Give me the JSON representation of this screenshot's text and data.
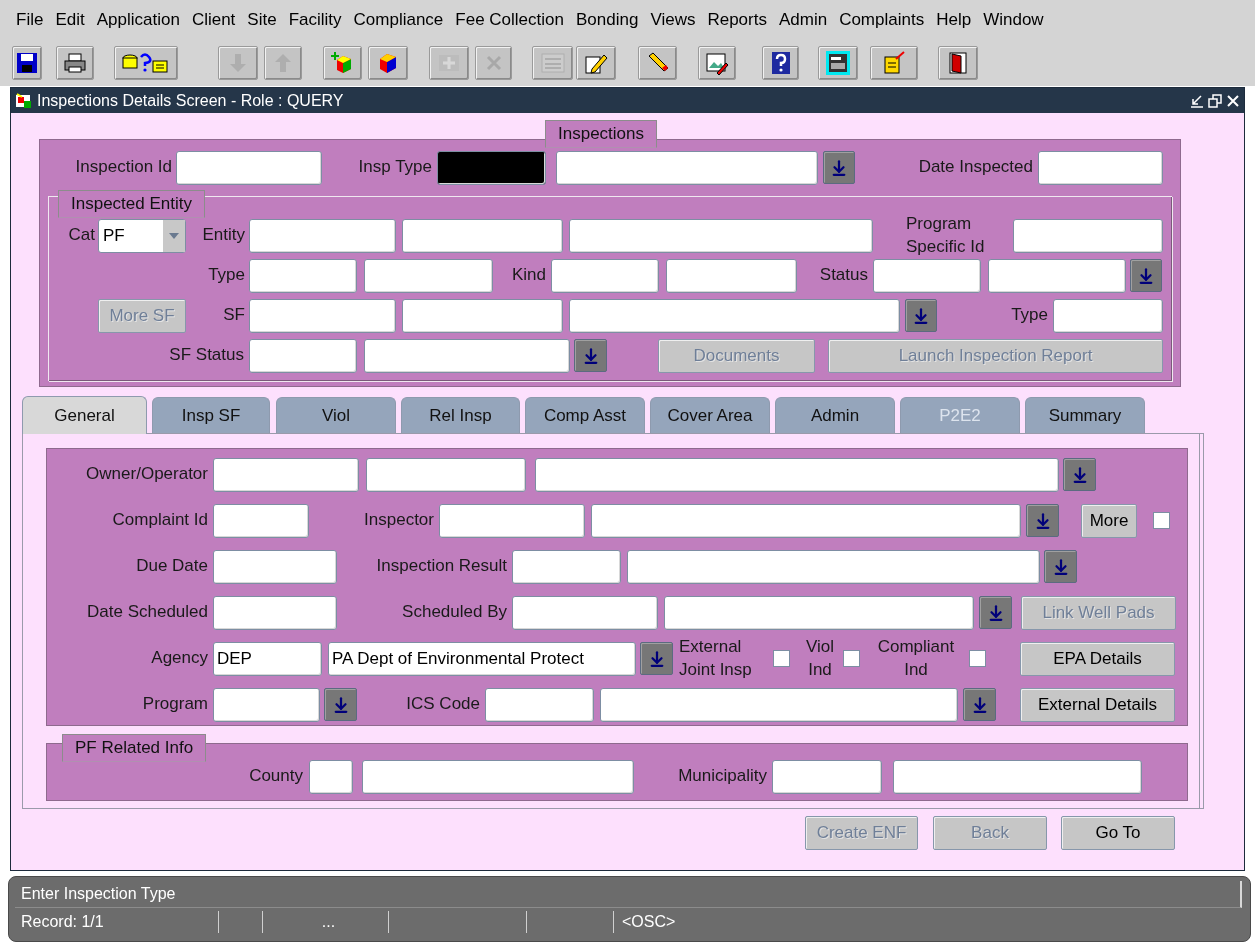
{
  "menu": [
    "File",
    "Edit",
    "Application",
    "Client",
    "Site",
    "Facility",
    "Compliance",
    "Fee Collection",
    "Bonding",
    "Views",
    "Reports",
    "Admin",
    "Complaints",
    "Help",
    "Window"
  ],
  "toolbar": [
    {
      "disabled": false
    },
    {
      "disabled": false
    },
    {
      "disabled": false
    },
    {
      "disabled": true
    },
    {
      "disabled": true
    },
    {
      "disabled": false
    },
    {
      "disabled": false
    },
    {
      "disabled": true
    },
    {
      "disabled": true
    },
    {
      "disabled": true
    },
    {
      "disabled": false
    },
    {
      "disabled": false
    },
    {
      "disabled": false
    },
    {
      "disabled": false
    },
    {
      "disabled": false
    },
    {
      "disabled": false
    },
    {
      "disabled": false
    }
  ],
  "window": {
    "title": "Inspections Details Screen - Role : QUERY"
  },
  "inspections": {
    "title": "Inspections",
    "rows": [
      {
        "items": [
          {
            "kind": "label",
            "text": "Inspection Id"
          },
          {
            "kind": "field"
          },
          {
            "kind": "label",
            "text": "Insp Type"
          },
          {
            "kind": "focused_field"
          },
          {
            "kind": "field"
          },
          {
            "kind": "lookup"
          },
          {
            "kind": "label",
            "text": "Date Inspected"
          },
          {
            "kind": "field"
          }
        ]
      }
    ],
    "entity": {
      "title": "Inspected Entity",
      "rows": [
        {
          "items": [
            {
              "kind": "label",
              "text": "Cat"
            },
            {
              "kind": "combo",
              "value": "PF"
            },
            {
              "kind": "label",
              "text": "Entity"
            },
            {
              "kind": "field"
            },
            {
              "kind": "field"
            },
            {
              "kind": "field"
            },
            {
              "kind": "label",
              "text": "Program Specific Id"
            },
            {
              "kind": "field"
            }
          ]
        },
        {
          "items": [
            {
              "kind": "label",
              "text": "Type"
            },
            {
              "kind": "field"
            },
            {
              "kind": "field"
            },
            {
              "kind": "label",
              "text": "Kind"
            },
            {
              "kind": "field"
            },
            {
              "kind": "field"
            },
            {
              "kind": "label",
              "text": "Status"
            },
            {
              "kind": "field"
            },
            {
              "kind": "field"
            },
            {
              "kind": "lookup"
            }
          ]
        },
        {
          "items": [
            {
              "kind": "button",
              "label": "More SF",
              "disabled": true
            },
            {
              "kind": "label",
              "text": "SF"
            },
            {
              "kind": "field"
            },
            {
              "kind": "field"
            },
            {
              "kind": "field"
            },
            {
              "kind": "lookup"
            },
            {
              "kind": "label",
              "text": "Type"
            },
            {
              "kind": "field"
            }
          ]
        },
        {
          "items": [
            {
              "kind": "label",
              "text": "SF Status"
            },
            {
              "kind": "field"
            },
            {
              "kind": "field"
            },
            {
              "kind": "lookup"
            },
            {
              "kind": "button",
              "label": "Documents",
              "disabled": true
            },
            {
              "kind": "button",
              "label": "Launch Inspection Report",
              "disabled": true
            }
          ]
        }
      ]
    }
  },
  "tabs": [
    {
      "label": "General",
      "selected": true,
      "disabled": false
    },
    {
      "label": "Insp SF",
      "selected": false,
      "disabled": false
    },
    {
      "label": "Viol",
      "selected": false,
      "disabled": false
    },
    {
      "label": "Rel Insp",
      "selected": false,
      "disabled": false
    },
    {
      "label": "Comp Asst",
      "selected": false,
      "disabled": false
    },
    {
      "label": "Cover Area",
      "selected": false,
      "disabled": false
    },
    {
      "label": "Admin",
      "selected": false,
      "disabled": false
    },
    {
      "label": "P2E2",
      "selected": false,
      "disabled": true
    },
    {
      "label": "Summary",
      "selected": false,
      "disabled": false
    }
  ],
  "general": {
    "rows": [
      {
        "items": [
          {
            "kind": "label",
            "text": "Owner/Operator"
          },
          {
            "kind": "field"
          },
          {
            "kind": "field"
          },
          {
            "kind": "field"
          },
          {
            "kind": "lookup"
          }
        ]
      },
      {
        "items": [
          {
            "kind": "label",
            "text": "Complaint Id"
          },
          {
            "kind": "field"
          },
          {
            "kind": "label",
            "text": "Inspector"
          },
          {
            "kind": "field"
          },
          {
            "kind": "field"
          },
          {
            "kind": "lookup"
          },
          {
            "kind": "button",
            "label": "More",
            "disabled": false
          },
          {
            "kind": "checkbox",
            "checked": false
          }
        ]
      },
      {
        "items": [
          {
            "kind": "label",
            "text": "Due Date"
          },
          {
            "kind": "field"
          },
          {
            "kind": "label",
            "text": "Inspection Result"
          },
          {
            "kind": "field"
          },
          {
            "kind": "field"
          },
          {
            "kind": "lookup"
          }
        ]
      },
      {
        "items": [
          {
            "kind": "label",
            "text": "Date Scheduled"
          },
          {
            "kind": "field"
          },
          {
            "kind": "label",
            "text": "Scheduled By"
          },
          {
            "kind": "field"
          },
          {
            "kind": "field"
          },
          {
            "kind": "lookup"
          },
          {
            "kind": "button",
            "label": "Link Well Pads",
            "disabled": true
          }
        ]
      },
      {
        "items": [
          {
            "kind": "label",
            "text": "Agency"
          },
          {
            "kind": "field",
            "value": "DEP"
          },
          {
            "kind": "field",
            "value": "PA Dept of Environmental Protect"
          },
          {
            "kind": "lookup"
          },
          {
            "kind": "label",
            "text": "External Joint Insp"
          },
          {
            "kind": "checkbox",
            "checked": false
          },
          {
            "kind": "label",
            "text": "Viol Ind"
          },
          {
            "kind": "checkbox",
            "checked": false
          },
          {
            "kind": "label",
            "text": "Compliant Ind"
          },
          {
            "kind": "checkbox",
            "checked": false
          },
          {
            "kind": "button",
            "label": "EPA Details",
            "disabled": false
          }
        ]
      },
      {
        "items": [
          {
            "kind": "label",
            "text": "Program"
          },
          {
            "kind": "field"
          },
          {
            "kind": "lookup"
          },
          {
            "kind": "label",
            "text": "ICS Code"
          },
          {
            "kind": "field"
          },
          {
            "kind": "field"
          },
          {
            "kind": "lookup"
          },
          {
            "kind": "button",
            "label": "External Details",
            "disabled": false
          }
        ]
      }
    ]
  },
  "pf_related_info": {
    "title": "PF Related Info",
    "rows": [
      {
        "items": [
          {
            "kind": "label",
            "text": "County"
          },
          {
            "kind": "field"
          },
          {
            "kind": "field"
          },
          {
            "kind": "label",
            "text": "Municipality"
          },
          {
            "kind": "field"
          },
          {
            "kind": "field"
          }
        ]
      }
    ]
  },
  "actions": [
    {
      "label": "Create ENF",
      "disabled": true
    },
    {
      "label": "Back",
      "disabled": true
    },
    {
      "label": "Go To",
      "disabled": false
    }
  ],
  "status_bar": {
    "message": "Enter Inspection Type",
    "record": "Record: 1/1",
    "ellipsis": "...",
    "mode": "<OSC>"
  }
}
